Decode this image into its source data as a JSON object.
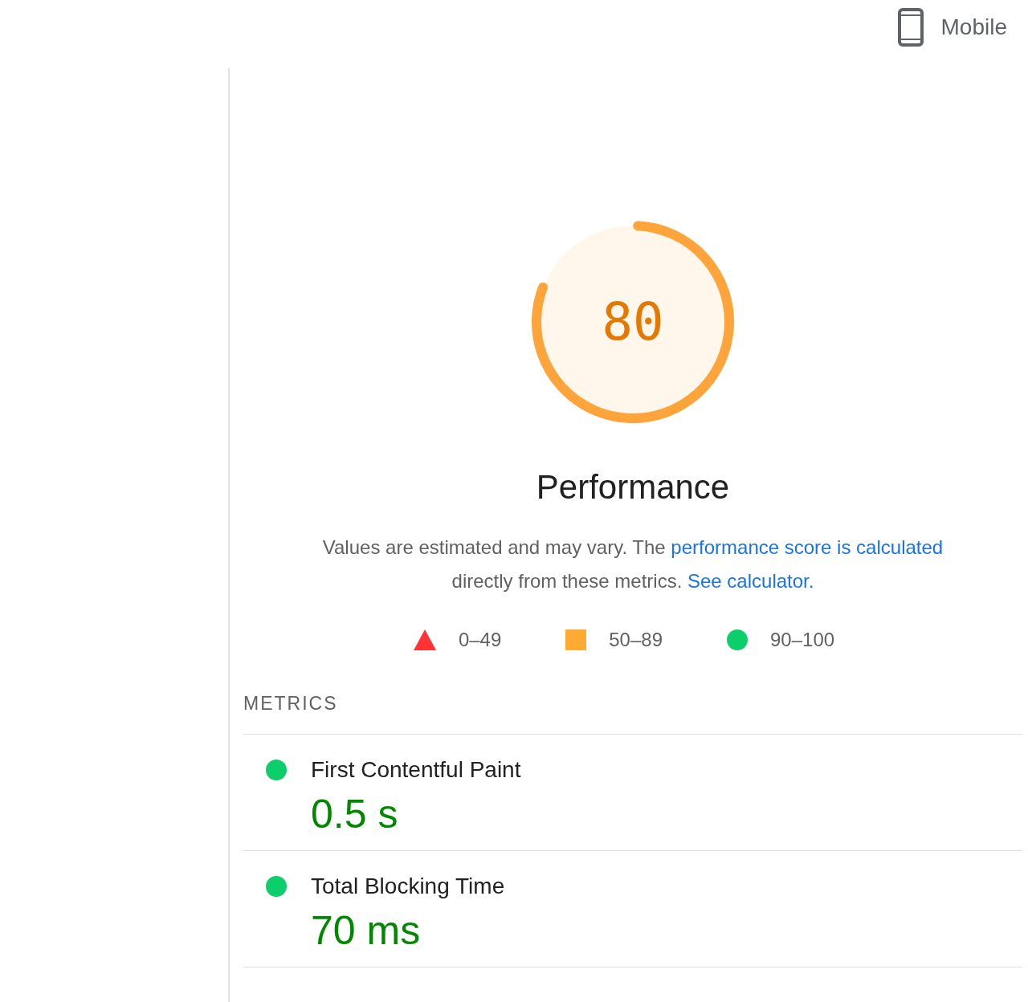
{
  "device_tab": {
    "label": "Mobile",
    "selected": true
  },
  "gauge": {
    "score": "80",
    "level": 0.8,
    "title": "Performance"
  },
  "description": {
    "text": "Values are estimated and may vary. The",
    "link": "performance score is calculated",
    "text2": "directly from these metrics.",
    "link2": "See calculator."
  },
  "legend": [
    {
      "kind": "triangle",
      "label": "0–49"
    },
    {
      "kind": "square",
      "label": "50–89"
    },
    {
      "kind": "circle",
      "label": "90–100"
    }
  ],
  "metrics_heading": "METRICS",
  "metrics": [
    {
      "name": "First Contentful Paint",
      "value": "0.5 s",
      "color": "#0cce6b"
    },
    {
      "name": "Total Blocking Time",
      "value": "70 ms",
      "color": "#0cce6b"
    }
  ]
}
